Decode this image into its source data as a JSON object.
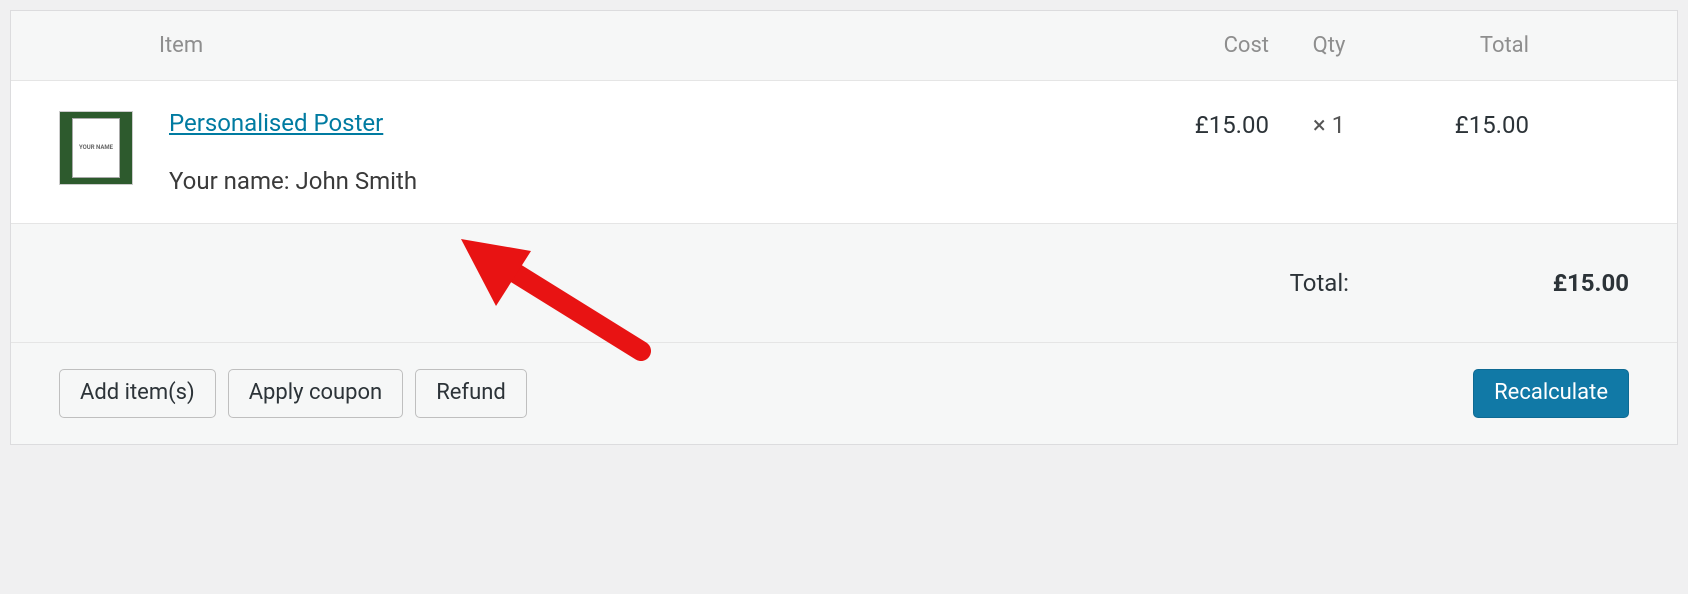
{
  "headers": {
    "item": "Item",
    "cost": "Cost",
    "qty": "Qty",
    "total": "Total"
  },
  "line_items": [
    {
      "thumb_text": "YOUR NAME",
      "name": "Personalised Poster",
      "meta_label": "Your name:",
      "meta_value": "John Smith",
      "cost": "£15.00",
      "qty_prefix": "×",
      "qty": "1",
      "total": "£15.00"
    }
  ],
  "totals": {
    "label": "Total:",
    "value": "£15.00"
  },
  "buttons": {
    "add_items": "Add item(s)",
    "apply_coupon": "Apply coupon",
    "refund": "Refund",
    "recalculate": "Recalculate"
  }
}
